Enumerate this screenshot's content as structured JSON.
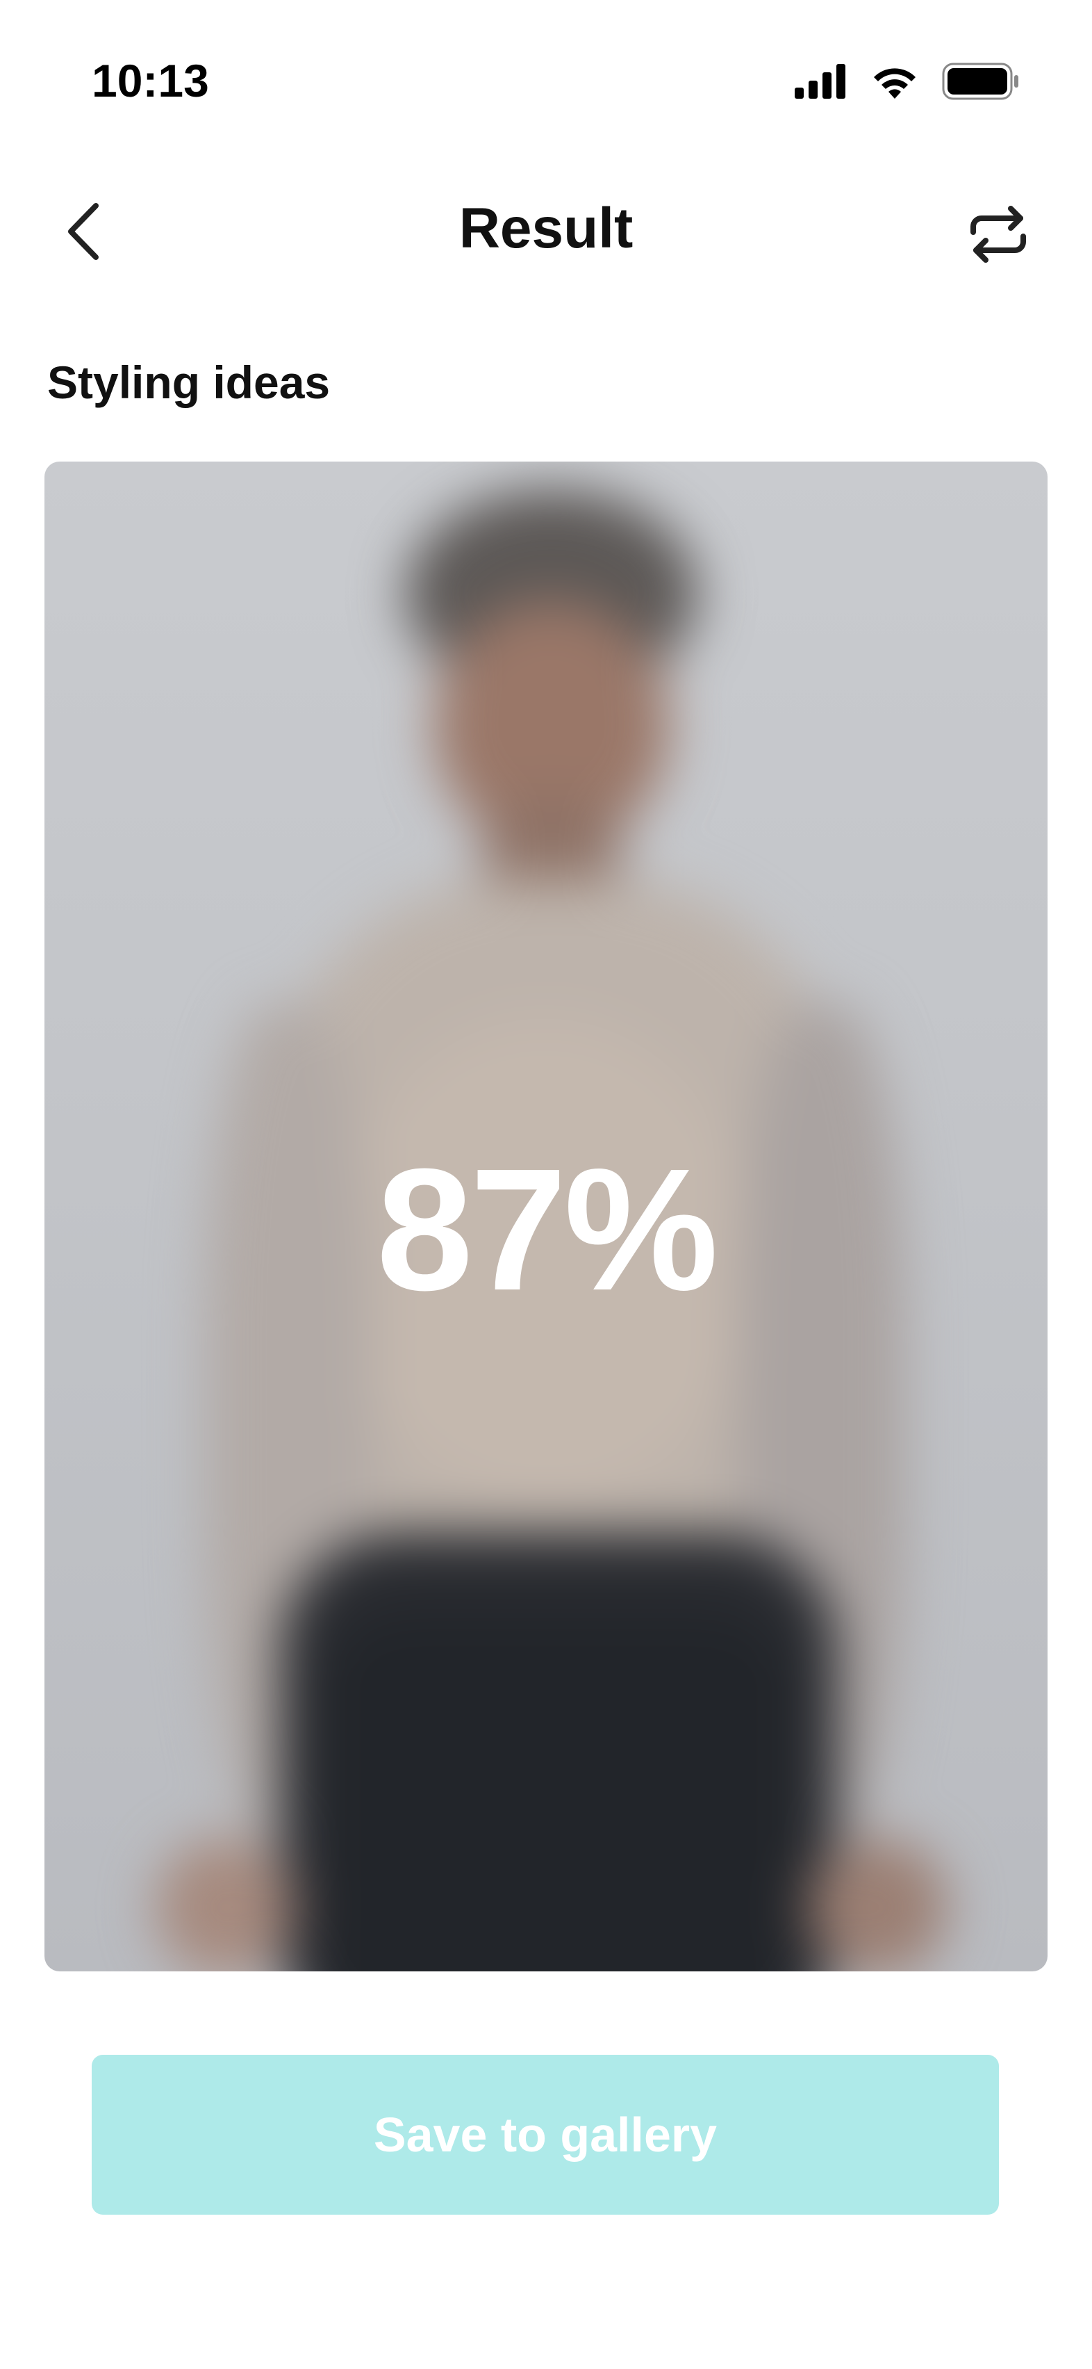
{
  "status_bar": {
    "time": "10:13",
    "icons": [
      "cellular-signal-icon",
      "wifi-icon",
      "battery-icon"
    ]
  },
  "nav": {
    "back_icon": "chevron-left-icon",
    "title": "Result",
    "action_icon": "repeat-icon"
  },
  "section": {
    "label": "Styling ideas"
  },
  "result_image": {
    "content": "blurred-photo",
    "progress_label": "87%",
    "progress": 0.87
  },
  "actions": {
    "save_label": "Save to gallery",
    "save_color": "#aeeae9",
    "save_text_color": "#ffffff"
  }
}
